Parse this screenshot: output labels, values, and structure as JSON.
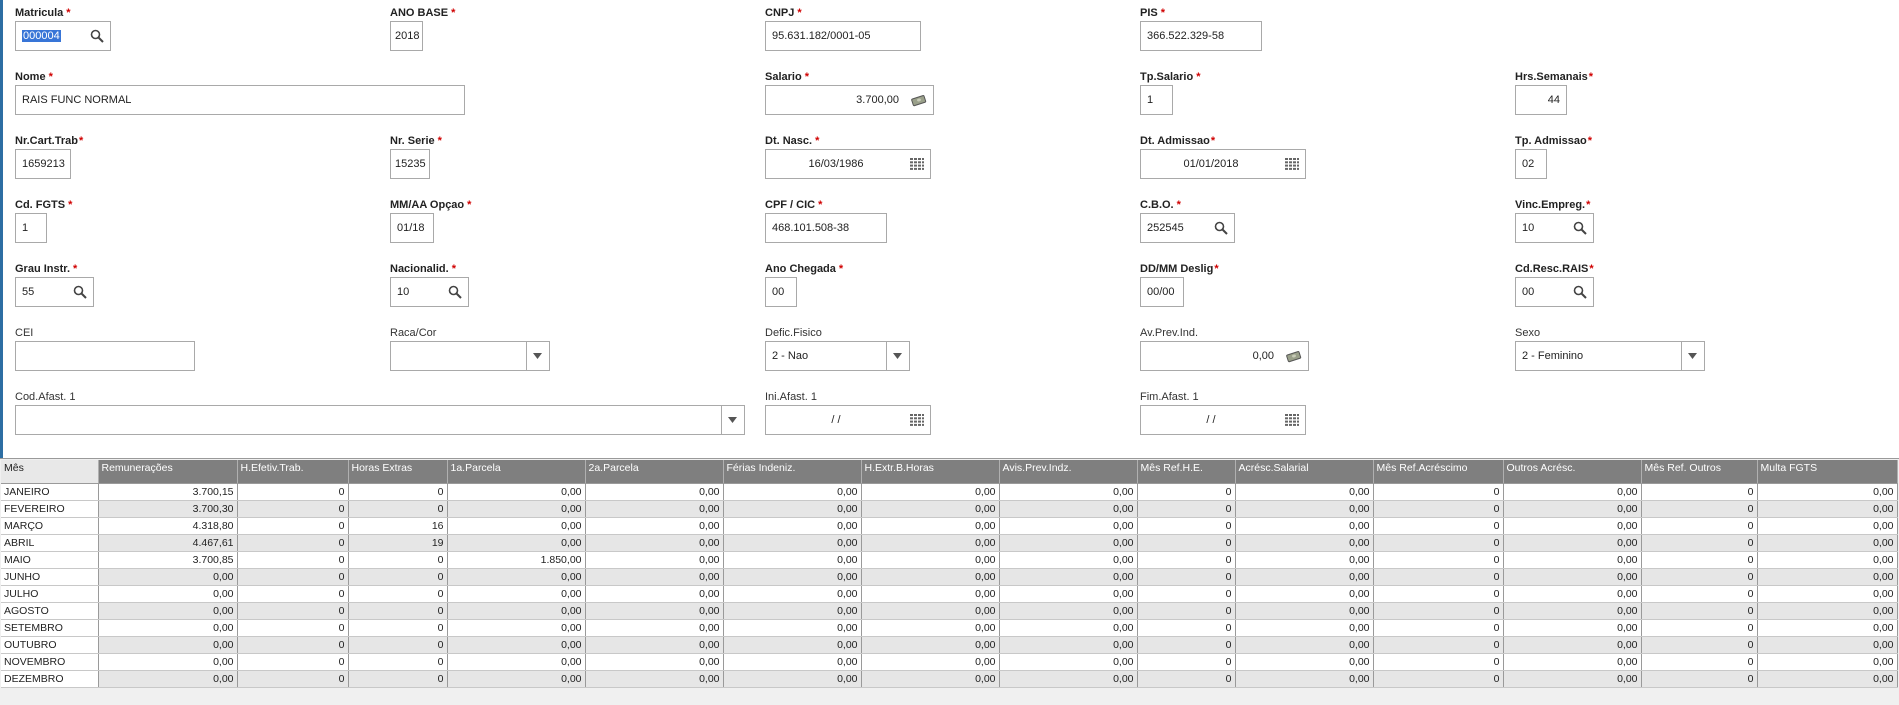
{
  "form": {
    "matricula": {
      "label": "Matricula",
      "value": "000004"
    },
    "ano_base": {
      "label": "ANO BASE",
      "value": "2018"
    },
    "cnpj": {
      "label": "CNPJ",
      "value": "95.631.182/0001-05"
    },
    "pis": {
      "label": "PIS",
      "value": "366.522.329-58"
    },
    "nome": {
      "label": "Nome",
      "value": "RAIS FUNC NORMAL"
    },
    "salario": {
      "label": "Salario",
      "value": "3.700,00"
    },
    "tp_salario": {
      "label": "Tp.Salario",
      "value": "1"
    },
    "hrs_semanais": {
      "label": "Hrs.Semanais",
      "value": "44"
    },
    "nr_cart_trab": {
      "label": "Nr.Cart.Trab",
      "value": "1659213"
    },
    "nr_serie": {
      "label": "Nr. Serie",
      "value": "15235"
    },
    "dt_nasc": {
      "label": "Dt. Nasc.",
      "value": "16/03/1986"
    },
    "dt_admissao": {
      "label": "Dt. Admissao",
      "value": "01/01/2018"
    },
    "tp_admissao": {
      "label": "Tp. Admissao",
      "value": "02"
    },
    "cd_fgts": {
      "label": "Cd. FGTS",
      "value": "1"
    },
    "mm_aa_opcao": {
      "label": "MM/AA Opçao",
      "value": "01/18"
    },
    "cpf_cic": {
      "label": "CPF / CIC",
      "value": "468.101.508-38"
    },
    "cbo": {
      "label": "C.B.O.",
      "value": "252545"
    },
    "vinc_empreg": {
      "label": "Vinc.Empreg.",
      "value": "10"
    },
    "grau_instr": {
      "label": "Grau Instr.",
      "value": "55"
    },
    "nacionalid": {
      "label": "Nacionalid.",
      "value": "10"
    },
    "ano_chegada": {
      "label": "Ano Chegada",
      "value": "00"
    },
    "dd_mm_deslig": {
      "label": "DD/MM Deslig",
      "value": "00/00"
    },
    "cd_resc_rais": {
      "label": "Cd.Resc.RAIS",
      "value": "00"
    },
    "cei": {
      "label": "CEI",
      "value": ""
    },
    "raca_cor": {
      "label": "Raca/Cor",
      "value": ""
    },
    "defic_fisico": {
      "label": "Defic.Fisico",
      "value": "2 - Nao"
    },
    "av_prev_ind": {
      "label": "Av.Prev.Ind.",
      "value": "0,00"
    },
    "sexo": {
      "label": "Sexo",
      "value": "2 - Feminino"
    },
    "cod_afast_1": {
      "label": "Cod.Afast. 1",
      "value": ""
    },
    "ini_afast_1": {
      "label": "Ini.Afast. 1",
      "value": "/ /"
    },
    "fim_afast_1": {
      "label": "Fim.Afast. 1",
      "value": "/ /"
    }
  },
  "icons": {
    "search": "magnifier-icon",
    "calendar": "calendar-icon",
    "money": "money-icon",
    "dropdown": "chevron-down-icon"
  },
  "colors": {
    "required": "#d00000",
    "grid_header": "#7f7f7f",
    "row_alt": "#e6e6e6",
    "selection": "#3875d7"
  },
  "grid": {
    "columns": [
      "Mês",
      "Remunerações",
      "H.Efetiv.Trab.",
      "Horas Extras",
      "1a.Parcela",
      "2a.Parcela",
      "Férias Indeniz.",
      "H.Extr.B.Horas",
      "Avis.Prev.Indz.",
      "Mês Ref.H.E.",
      "Acrésc.Salarial",
      "Mês Ref.Acréscimo",
      "Outros Acrésc.",
      "Mês Ref. Outros",
      "Multa FGTS"
    ],
    "rows": [
      [
        "JANEIRO",
        "3.700,15",
        "0",
        "0",
        "0,00",
        "0,00",
        "0,00",
        "0,00",
        "0,00",
        "0",
        "0,00",
        "0",
        "0,00",
        "0",
        "0,00"
      ],
      [
        "FEVEREIRO",
        "3.700,30",
        "0",
        "0",
        "0,00",
        "0,00",
        "0,00",
        "0,00",
        "0,00",
        "0",
        "0,00",
        "0",
        "0,00",
        "0",
        "0,00"
      ],
      [
        "MARÇO",
        "4.318,80",
        "0",
        "16",
        "0,00",
        "0,00",
        "0,00",
        "0,00",
        "0,00",
        "0",
        "0,00",
        "0",
        "0,00",
        "0",
        "0,00"
      ],
      [
        "ABRIL",
        "4.467,61",
        "0",
        "19",
        "0,00",
        "0,00",
        "0,00",
        "0,00",
        "0,00",
        "0",
        "0,00",
        "0",
        "0,00",
        "0",
        "0,00"
      ],
      [
        "MAIO",
        "3.700,85",
        "0",
        "0",
        "1.850,00",
        "0,00",
        "0,00",
        "0,00",
        "0,00",
        "0",
        "0,00",
        "0",
        "0,00",
        "0",
        "0,00"
      ],
      [
        "JUNHO",
        "0,00",
        "0",
        "0",
        "0,00",
        "0,00",
        "0,00",
        "0,00",
        "0,00",
        "0",
        "0,00",
        "0",
        "0,00",
        "0",
        "0,00"
      ],
      [
        "JULHO",
        "0,00",
        "0",
        "0",
        "0,00",
        "0,00",
        "0,00",
        "0,00",
        "0,00",
        "0",
        "0,00",
        "0",
        "0,00",
        "0",
        "0,00"
      ],
      [
        "AGOSTO",
        "0,00",
        "0",
        "0",
        "0,00",
        "0,00",
        "0,00",
        "0,00",
        "0,00",
        "0",
        "0,00",
        "0",
        "0,00",
        "0",
        "0,00"
      ],
      [
        "SETEMBRO",
        "0,00",
        "0",
        "0",
        "0,00",
        "0,00",
        "0,00",
        "0,00",
        "0,00",
        "0",
        "0,00",
        "0",
        "0,00",
        "0",
        "0,00"
      ],
      [
        "OUTUBRO",
        "0,00",
        "0",
        "0",
        "0,00",
        "0,00",
        "0,00",
        "0,00",
        "0,00",
        "0",
        "0,00",
        "0",
        "0,00",
        "0",
        "0,00"
      ],
      [
        "NOVEMBRO",
        "0,00",
        "0",
        "0",
        "0,00",
        "0,00",
        "0,00",
        "0,00",
        "0,00",
        "0",
        "0,00",
        "0",
        "0,00",
        "0",
        "0,00"
      ],
      [
        "DEZEMBRO",
        "0,00",
        "0",
        "0",
        "0,00",
        "0,00",
        "0,00",
        "0,00",
        "0,00",
        "0",
        "0,00",
        "0",
        "0,00",
        "0",
        "0,00"
      ]
    ]
  }
}
